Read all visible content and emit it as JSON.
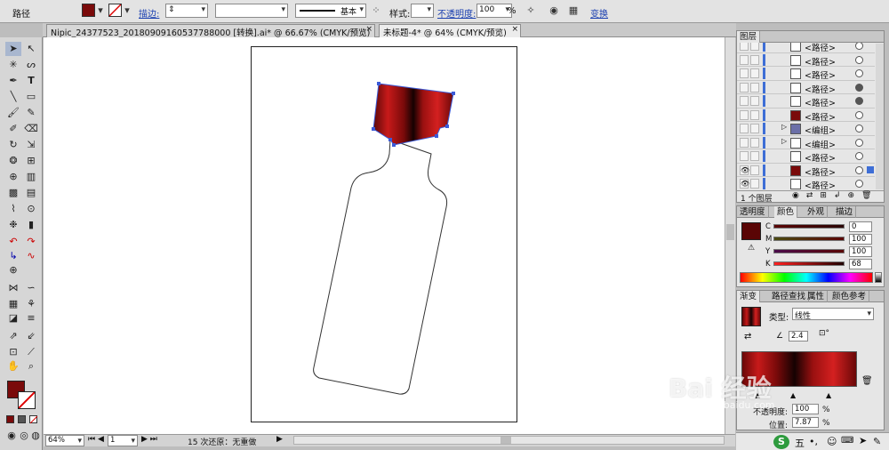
{
  "control_bar": {
    "object_type": "路径",
    "stroke_label": "描边:",
    "stroke_style": "基本",
    "style_label": "样式:",
    "opacity_label": "不透明度:",
    "opacity_value": "100",
    "opacity_unit": "%",
    "transform_label": "变换",
    "fill_color": "#7a0a0a"
  },
  "tabs": [
    {
      "label": "Nipic_24377523_20180909160537788000  [转换].ai* @ 66.67% (CMYK/预览)",
      "close": "×"
    },
    {
      "label": "未标题-4* @ 64% (CMYK/预览)",
      "close": "×"
    }
  ],
  "status": {
    "zoom": "64%",
    "page": "1",
    "undo_text": "15 次还原：无重做"
  },
  "layers_panel": {
    "title": "图层",
    "rows": [
      {
        "name": "<路径>",
        "target_filled": false
      },
      {
        "name": "<路径>",
        "target_filled": false
      },
      {
        "name": "<路径>",
        "target_filled": false
      },
      {
        "name": "<路径>",
        "target_filled": true
      },
      {
        "name": "<路径>",
        "target_filled": true
      },
      {
        "name": "<路径>",
        "target_filled": false
      },
      {
        "name": "<编组>",
        "target_filled": false
      },
      {
        "name": "<编组>",
        "target_filled": false
      },
      {
        "name": "<路径>",
        "target_filled": false
      },
      {
        "name": "<路径>",
        "target_filled": false
      },
      {
        "name": "<路径>",
        "target_filled": false
      }
    ],
    "footer": "1 个图层"
  },
  "color_panel": {
    "tabs": [
      "透明度",
      "颜色",
      "外观",
      "描边"
    ],
    "channels": [
      {
        "name": "C",
        "value": "0"
      },
      {
        "name": "M",
        "value": "100"
      },
      {
        "name": "Y",
        "value": "100"
      },
      {
        "name": "K",
        "value": "68"
      }
    ],
    "swatch_color": "#5a0505"
  },
  "gradient_panel": {
    "tabs": [
      "渐变",
      "路径查找",
      "属性",
      "颜色参考"
    ],
    "type_label": "类型:",
    "type_value": "线性",
    "angle_value": "2.4",
    "opacity_label": "不透明度:",
    "opacity_value": "100",
    "opacity_unit": "%",
    "location_label": "位置:",
    "location_value": "7.87",
    "location_unit": "%"
  },
  "watermark": {
    "line1": "Bai 经验",
    "line2": "jingyan.baidu.com"
  },
  "taskbar": {
    "ime_char": "五"
  }
}
